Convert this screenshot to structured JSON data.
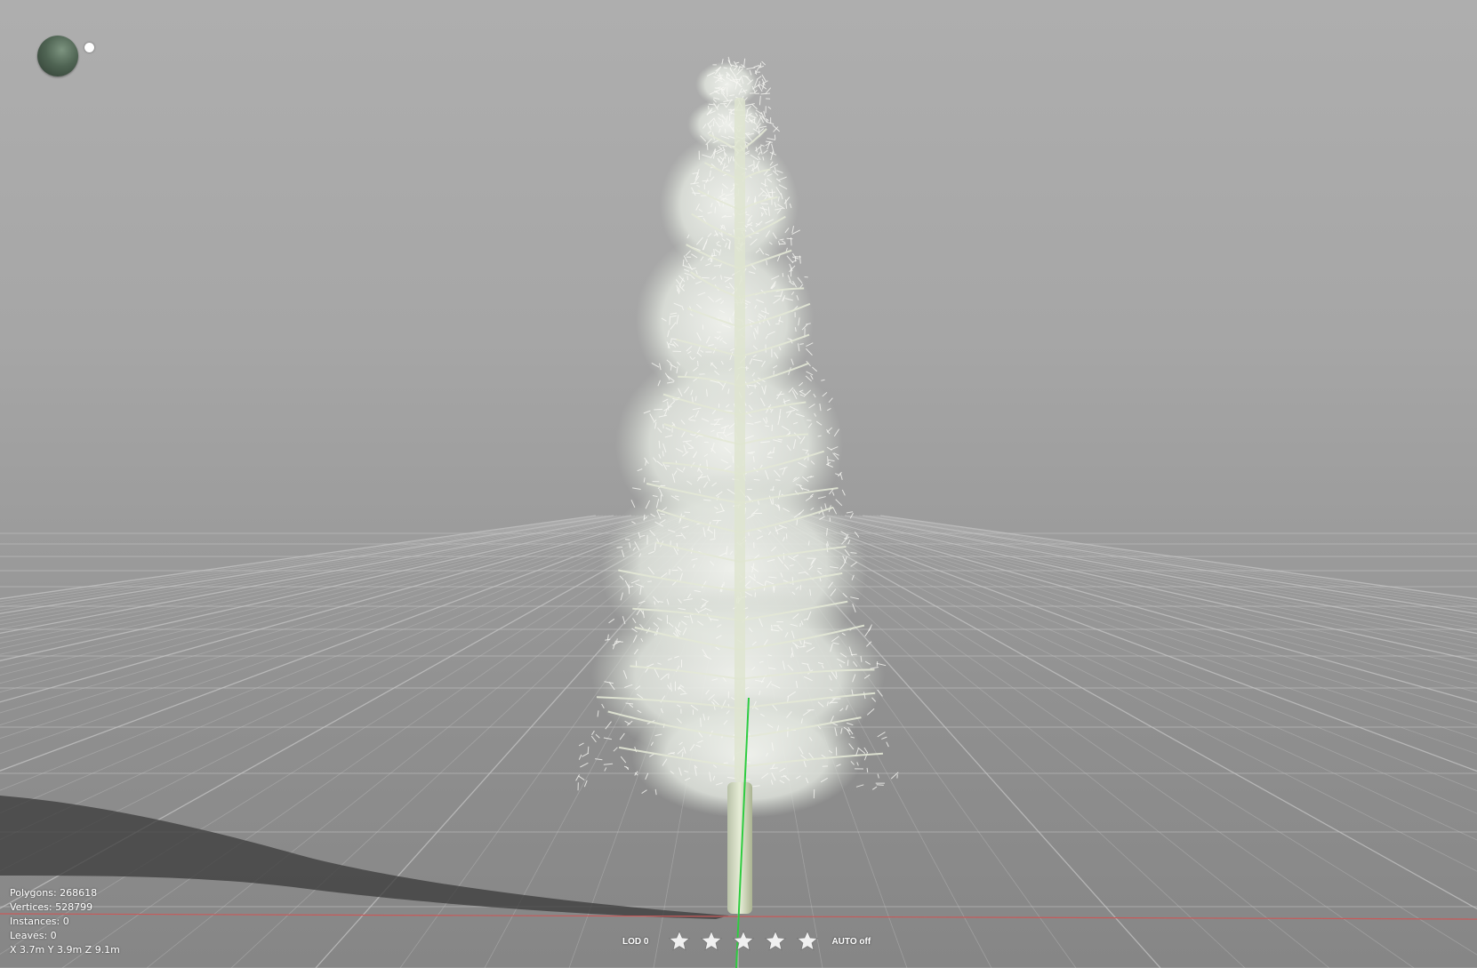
{
  "viewport": {
    "background_top": "#aeaeae",
    "background_bottom": "#868686",
    "grid_color": "#c4c4c4",
    "x_axis_color": "#c85a5a",
    "y_axis_color": "#2ecc40"
  },
  "light_gizmo": {
    "icon": "light-direction-sphere-icon",
    "handle_icon": "light-handle-icon"
  },
  "stats": {
    "polygons": "Polygons: 268618",
    "vertices": "Vertices: 528799",
    "instances": "Instances: 0",
    "leaves": "Leaves: 0",
    "dimensions": "X 3.7m Y 3.9m Z 9.1m"
  },
  "lod_bar": {
    "lod_label": "LOD 0",
    "star_icon": "star-icon",
    "star_count": 5,
    "auto_label": "AUTO off"
  }
}
